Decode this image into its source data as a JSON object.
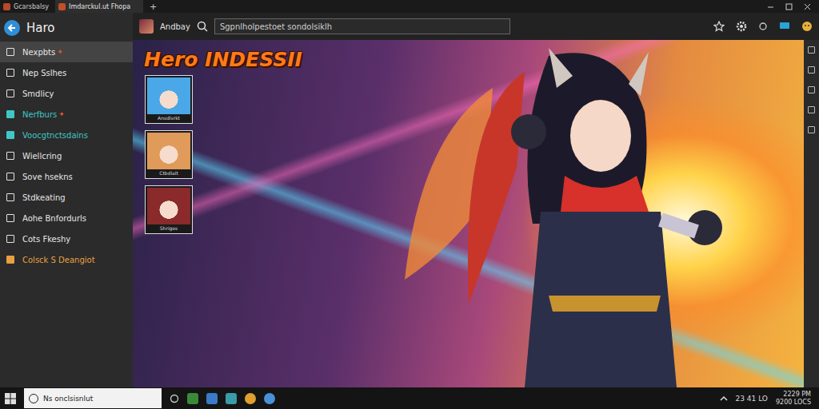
{
  "window": {
    "tabs": [
      {
        "label": "Gcarsbalsy",
        "selected": false
      },
      {
        "label": "Imdarckul.ut Fhopa",
        "selected": true
      }
    ],
    "new_tab": "+"
  },
  "sidebar": {
    "title": "Haro",
    "items": [
      {
        "label": "Nexpbts",
        "selected": true,
        "color": "#e6e6e6",
        "badge": "✦"
      },
      {
        "label": "Nep Sslhes",
        "selected": false,
        "color": "#e6e6e6",
        "badge": ""
      },
      {
        "label": "Smdlicy",
        "selected": false,
        "color": "#e6e6e6",
        "badge": ""
      },
      {
        "label": "Nerfburs",
        "selected": false,
        "color": "#3fc7c7",
        "badge": "✦"
      },
      {
        "label": "Voocgtnctsdains",
        "selected": false,
        "color": "#3fc7c7",
        "badge": ""
      },
      {
        "label": "Wiellcring",
        "selected": false,
        "color": "#e6e6e6",
        "badge": ""
      },
      {
        "label": "Sove hsekns",
        "selected": false,
        "color": "#e6e6e6",
        "badge": ""
      },
      {
        "label": "Stdkeating",
        "selected": false,
        "color": "#e6e6e6",
        "badge": ""
      },
      {
        "label": "Aohe Bnfordurls",
        "selected": false,
        "color": "#e6e6e6",
        "badge": ""
      },
      {
        "label": "Cots Fkeshy",
        "selected": false,
        "color": "#e6e6e6",
        "badge": ""
      },
      {
        "label": "Colsck S Deangiot",
        "selected": false,
        "color": "#e8a040",
        "badge": ""
      }
    ]
  },
  "toolbar": {
    "app_label": "Andbay",
    "search": {
      "placeholder": "Sgpnlholpestoet sondolsiklh"
    }
  },
  "hero": {
    "title": "Hero INDESSII",
    "thumbnails": [
      {
        "label": "Ansdlsrkt",
        "color": "#4aa8e8"
      },
      {
        "label": "Ctbdlalt",
        "color": "#e09a5a"
      },
      {
        "label": "Shrigos",
        "color": "#8a2a2a"
      }
    ]
  },
  "taskbar": {
    "search": "Ns onclsisnlut",
    "tray": "23 41 LO",
    "clock": [
      "2229 PM",
      "9200 LOCS"
    ]
  }
}
